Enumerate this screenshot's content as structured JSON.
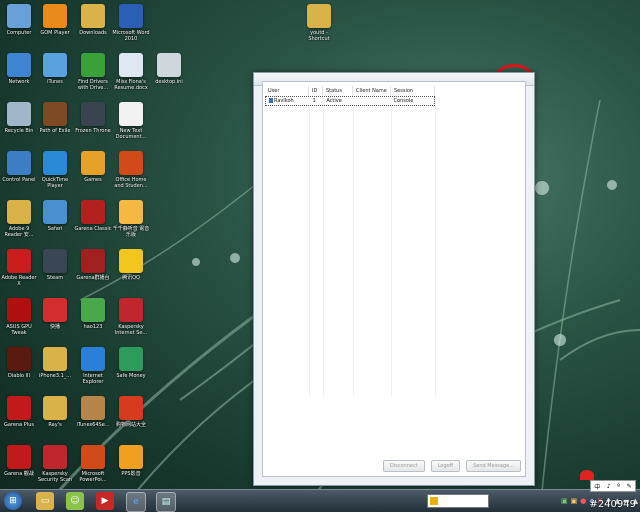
{
  "desktop": {
    "icons": [
      {
        "label": "Computer",
        "icon": "computer-icon",
        "color": "#6aa0d8"
      },
      {
        "label": "GOM Player",
        "icon": "gom-player-icon",
        "color": "#e98a1a"
      },
      {
        "label": "Downloads",
        "icon": "folder-icon",
        "color": "#d9b24a"
      },
      {
        "label": "Microsoft Word 2010",
        "icon": "word-icon",
        "color": "#2b5eb7"
      },
      {
        "label": "Network",
        "icon": "network-icon",
        "color": "#3f84d0"
      },
      {
        "label": "iTunes",
        "icon": "itunes-icon",
        "color": "#5aa1e0"
      },
      {
        "label": "Find Drivers with Drive...",
        "icon": "driver-icon",
        "color": "#3aa03a"
      },
      {
        "label": "Miss Fiona's Resume.docx",
        "icon": "doc-icon",
        "color": "#dfe7f3"
      },
      {
        "label": "desktop.ini",
        "icon": "ini-icon",
        "color": "#cfd6dc"
      },
      {
        "label": "Recycle Bin",
        "icon": "recycle-bin-icon",
        "color": "#9fb6c8"
      },
      {
        "label": "Path of Exile",
        "icon": "poe-icon",
        "color": "#7d4a25"
      },
      {
        "label": "Frozen Throne",
        "icon": "frozen-throne-icon",
        "color": "#3a4450"
      },
      {
        "label": "New Text Document...",
        "icon": "text-doc-icon",
        "color": "#f2f2f2"
      },
      {
        "label": "Control Panel",
        "icon": "control-panel-icon",
        "color": "#3d7dc4"
      },
      {
        "label": "QuickTime Player",
        "icon": "quicktime-icon",
        "color": "#2a8ad8"
      },
      {
        "label": "Games",
        "icon": "games-icon",
        "color": "#e6a12a"
      },
      {
        "label": "Office Home and Studen...",
        "icon": "office-icon",
        "color": "#d24a1a"
      },
      {
        "label": "Adobe 9 Reader 安...",
        "icon": "folder-icon",
        "color": "#d9b24a"
      },
      {
        "label": "Safari",
        "icon": "safari-icon",
        "color": "#4a90d0"
      },
      {
        "label": "Garena Classic",
        "icon": "garena-icon",
        "color": "#b32020"
      },
      {
        "label": "千千静听音 電音乐版",
        "icon": "ttplayer-icon",
        "color": "#f5b840"
      },
      {
        "label": "Adobe Reader X",
        "icon": "adobe-reader-icon",
        "color": "#c91d1d"
      },
      {
        "label": "Steam",
        "icon": "steam-icon",
        "color": "#3b4654"
      },
      {
        "label": "Garena群播台",
        "icon": "garena-icon",
        "color": "#a02020"
      },
      {
        "label": "腾讯QQ",
        "icon": "qq-icon",
        "color": "#f2c61f"
      },
      {
        "label": "ASUS GPU Tweak",
        "icon": "asus-gpu-icon",
        "color": "#b01010"
      },
      {
        "label": "快播",
        "icon": "kuaibo-icon",
        "color": "#d42d2d"
      },
      {
        "label": "hao123",
        "icon": "hao123-icon",
        "color": "#48a84b"
      },
      {
        "label": "Kaspersky Internet Se...",
        "icon": "kaspersky-icon",
        "color": "#c0262d"
      },
      {
        "label": "Diablo III",
        "icon": "diablo-icon",
        "color": "#5a1a10"
      },
      {
        "label": "iPhone3.1_...",
        "icon": "folder-icon",
        "color": "#d9b24a"
      },
      {
        "label": "Internet Explorer",
        "icon": "ie-icon",
        "color": "#2b7fd6"
      },
      {
        "label": "Safe Money",
        "icon": "safe-money-icon",
        "color": "#2c9b5b"
      },
      {
        "label": "Garena Plus",
        "icon": "garena-plus-icon",
        "color": "#c01a1a"
      },
      {
        "label": "Ray's",
        "icon": "folder-icon",
        "color": "#d9b24a"
      },
      {
        "label": "iTunes64Se...",
        "icon": "package-icon",
        "color": "#b6854a"
      },
      {
        "label": "购物网站大全",
        "icon": "shopping-icon",
        "color": "#d63b1f"
      },
      {
        "label": "Garena 觀战",
        "icon": "garena-icon",
        "color": "#c01a1a"
      },
      {
        "label": "Kaspersky Security Scan",
        "icon": "kaspersky-icon",
        "color": "#c0262d"
      },
      {
        "label": "Microsoft PowerPoi...",
        "icon": "powerpoint-icon",
        "color": "#d04a1a"
      },
      {
        "label": "PPS影音",
        "icon": "pps-icon",
        "color": "#f0a020"
      },
      {
        "label": "youtd - Shortcut",
        "icon": "folder-icon",
        "color": "#d9b24a"
      }
    ]
  },
  "window": {
    "columns": [
      "User",
      "ID",
      "Status",
      "Client Name",
      "Session"
    ],
    "rows": [
      {
        "user": "Ravikoh",
        "id": "1",
        "status": "Active",
        "client": "",
        "session": "Console"
      }
    ],
    "buttons": {
      "disconnect": "Disconnect",
      "logoff": "Logoff",
      "send": "Send Message..."
    }
  },
  "taskbar": {
    "watermark": "#240949",
    "ime": [
      "中",
      "♪",
      "º",
      "✎"
    ]
  },
  "colors": {
    "annotation": "#e0141b"
  }
}
